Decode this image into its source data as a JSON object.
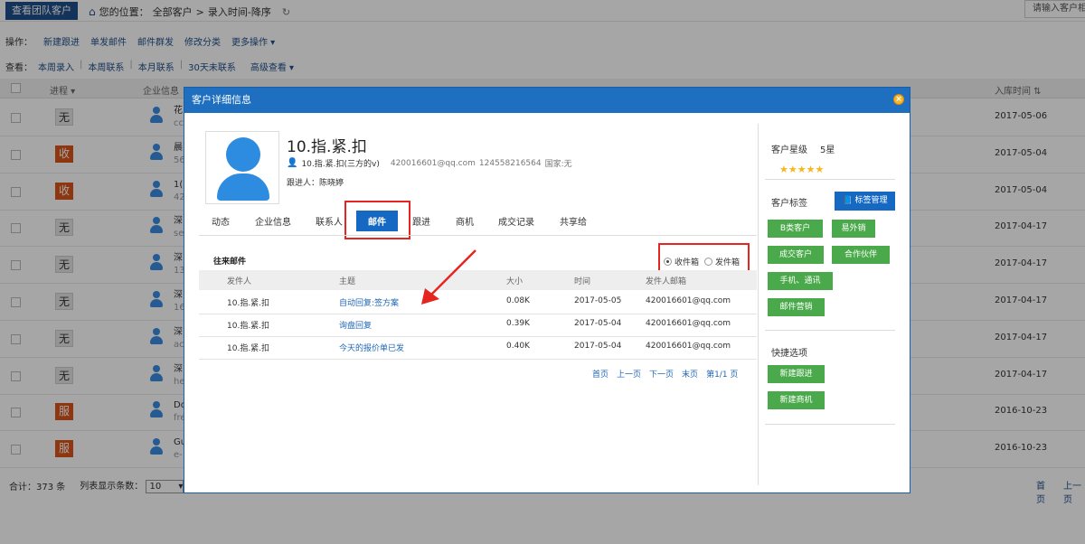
{
  "header": {
    "team_button": "查看团队客户",
    "location_label": "您的位置：",
    "crumb_all": "全部客户",
    "crumb_sep": ">",
    "crumb_current": "录入时间-降序",
    "search_placeholder": "请输入客户相"
  },
  "ops": {
    "label": "操作：",
    "items": [
      "新建跟进",
      "单发邮件",
      "邮件群发",
      "修改分类",
      "更多操作 ▾"
    ]
  },
  "views": {
    "label": "查看：",
    "items": [
      "本周录入",
      "本周联系",
      "本月联系",
      "30天未联系",
      "高级查看 ▾"
    ]
  },
  "table": {
    "col_progress": "进程 ▾",
    "col_company": "企业信息",
    "col_date": "入库时间 ⇅",
    "rows": [
      {
        "status": "无",
        "t1": "花",
        "t2": "cc",
        "date": "2017-05-06"
      },
      {
        "status": "收",
        "t1": "晨",
        "t2": "56",
        "date": "2017-05-04"
      },
      {
        "status": "收",
        "t1": "1(",
        "t2": "42",
        "date": "2017-05-04"
      },
      {
        "status": "无",
        "t1": "深",
        "t2": "se",
        "date": "2017-04-17"
      },
      {
        "status": "无",
        "t1": "深",
        "t2": "13",
        "date": "2017-04-17"
      },
      {
        "status": "无",
        "t1": "深",
        "t2": "16",
        "date": "2017-04-17"
      },
      {
        "status": "无",
        "t1": "深",
        "t2": "ac",
        "date": "2017-04-17"
      },
      {
        "status": "无",
        "t1": "深",
        "t2": "he",
        "date": "2017-04-17"
      },
      {
        "status": "服",
        "t1": "Do",
        "t2": "fre",
        "date": "2016-10-23"
      },
      {
        "status": "服",
        "t1": "Gu",
        "t2": "e-",
        "date": "2016-10-23"
      }
    ]
  },
  "footer": {
    "total": "合计：373 条",
    "per_page_label": "列表显示条数：",
    "per_page_value": "10",
    "first": "首页",
    "prev": "上一页"
  },
  "modal": {
    "title": "客户详细信息",
    "customer_name": "10.指.紧.扣",
    "contact_name": "10.指.紧.扣(三方的v)",
    "email": "420016601@qq.com",
    "phone": "124558216564",
    "country": "国家:无",
    "owner": "跟进人：陈晓婷",
    "tabs": [
      "动态",
      "企业信息",
      "联系人",
      "邮件",
      "跟进",
      "商机",
      "成交记录",
      "共享给"
    ],
    "mail": {
      "title": "往来邮件",
      "inbox": "收件箱",
      "outbox": "发件箱",
      "headers": [
        "发件人",
        "主题",
        "大小",
        "时间",
        "发件人邮箱"
      ],
      "rows": [
        {
          "sender": "10.指.紧.扣",
          "subject": "自动回复:签方案",
          "size": "0.08K",
          "time": "2017-05-05",
          "from": "420016601@qq.com"
        },
        {
          "sender": "10.指.紧.扣",
          "subject": "询盘回复",
          "size": "0.39K",
          "time": "2017-05-04",
          "from": "420016601@qq.com"
        },
        {
          "sender": "10.指.紧.扣",
          "subject": "今天的报价单已发",
          "size": "0.40K",
          "time": "2017-05-04",
          "from": "420016601@qq.com"
        }
      ],
      "pager": [
        "首页",
        "上一页",
        "下一页",
        "末页",
        "第1/1 页"
      ]
    },
    "side": {
      "level_label": "客户星级",
      "level_value": "5星",
      "stars": "★★★★★",
      "tags_label": "客户标签",
      "tag_manage": "标签管理",
      "tags": [
        "B类客户",
        "易外销",
        "成交客户",
        "合作伙伴",
        "手机、通讯",
        "邮件营销"
      ],
      "quick_label": "快捷选项",
      "quick": [
        "新建跟进",
        "新建商机"
      ]
    }
  },
  "colors": {
    "accent": "#1669c3",
    "highlight": "#e52520",
    "tag_green": "#4aa94a",
    "badge_orange": "#d9541a"
  }
}
